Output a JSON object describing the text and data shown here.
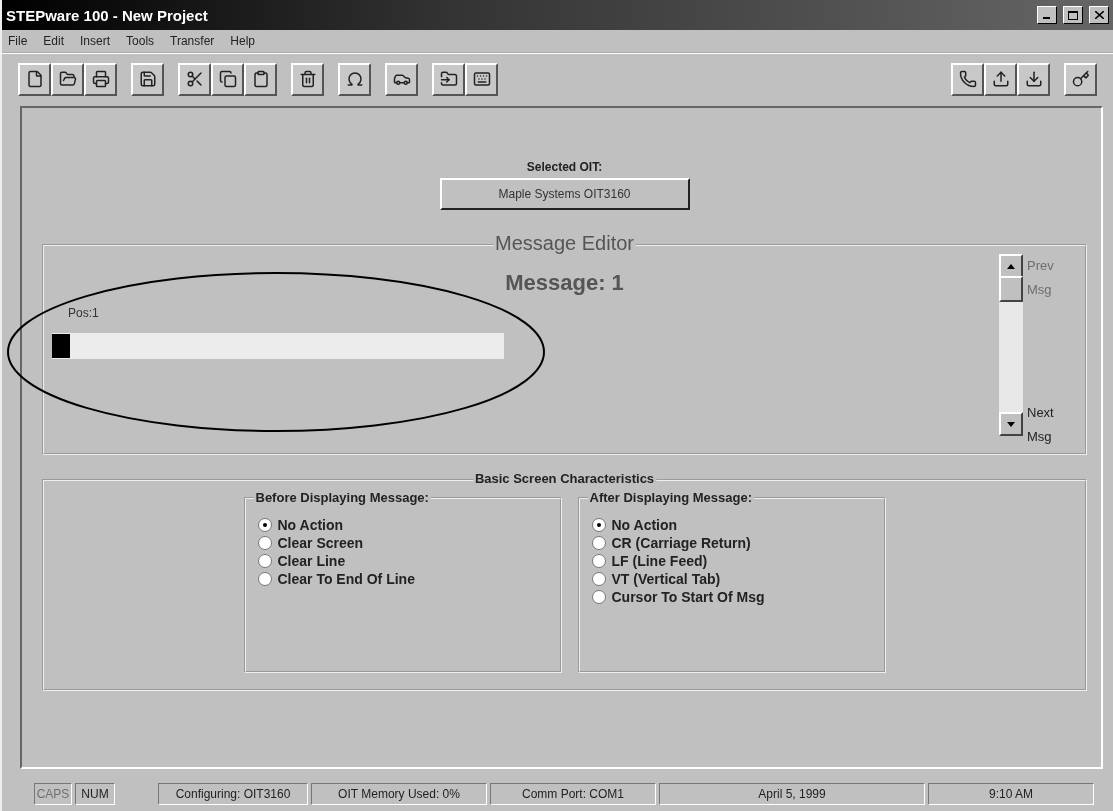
{
  "window": {
    "title": "STEPware 100 - New Project"
  },
  "menu": [
    "File",
    "Edit",
    "Insert",
    "Tools",
    "Transfer",
    "Help"
  ],
  "selected_oit": {
    "label": "Selected OIT:",
    "button": "Maple Systems OIT3160"
  },
  "message_editor": {
    "title": "Message Editor",
    "heading": "Message: 1",
    "position": "Pos:1",
    "prev": {
      "label": "Prev Msg",
      "disabled": true
    },
    "next": {
      "label": "Next Msg",
      "disabled": false
    }
  },
  "annotation": {
    "kind": "ellipse"
  },
  "screen_characteristics": {
    "title": "Basic Screen Characteristics",
    "groups": [
      {
        "title": "Before Displaying Message:",
        "options": [
          {
            "label": "No Action",
            "selected": true
          },
          {
            "label": "Clear Screen",
            "selected": false
          },
          {
            "label": "Clear Line",
            "selected": false
          },
          {
            "label": "Clear To End Of Line",
            "selected": false
          }
        ]
      },
      {
        "title": "After Displaying Message:",
        "options": [
          {
            "label": "No Action",
            "selected": true
          },
          {
            "label": "CR (Carriage Return)",
            "selected": false
          },
          {
            "label": "LF (Line Feed)",
            "selected": false
          },
          {
            "label": "VT (Vertical Tab)",
            "selected": false
          },
          {
            "label": "Cursor To Start Of Msg",
            "selected": false
          }
        ]
      }
    ]
  },
  "status_bar": [
    {
      "text": "CAPS",
      "disabled": true
    },
    {
      "text": "NUM",
      "disabled": false
    },
    {
      "text": "Configuring: OIT3160",
      "disabled": false
    },
    {
      "text": "OIT Memory Used: 0%",
      "disabled": false
    },
    {
      "text": "Comm Port: COM1",
      "disabled": false
    },
    {
      "text": "April 5, 1999",
      "disabled": false
    },
    {
      "text": "9:10 AM",
      "disabled": false
    }
  ]
}
